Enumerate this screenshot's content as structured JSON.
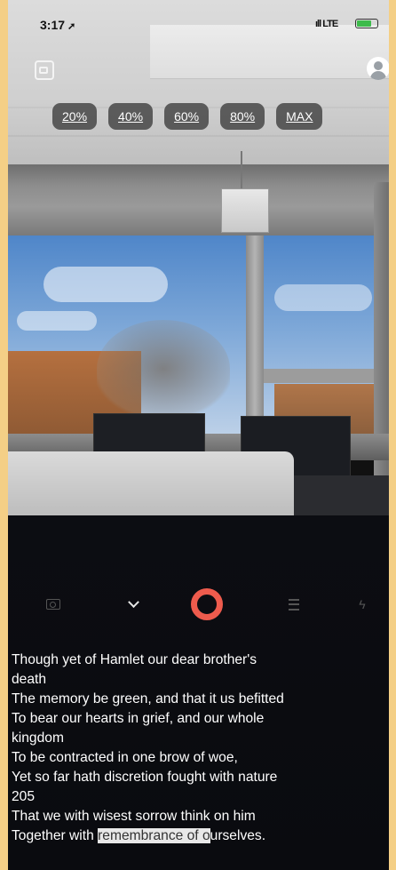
{
  "status_bar": {
    "time": "3:17",
    "location_glyph": "➚",
    "signal": "ıll LTE"
  },
  "zoom_options": [
    "20%",
    "40%",
    "60%",
    "80%",
    "MAX"
  ],
  "icons": {
    "gallery": "gallery-icon",
    "profile": "profile-icon",
    "camera": "camera-icon",
    "collapse": "chevron-down-icon",
    "record": "record-icon",
    "menu": "menu-icon",
    "flash": "flash-icon",
    "flash_glyph": "ϟ"
  },
  "colors": {
    "record": "#ee5b4d",
    "battery": "#3dbb4b",
    "background_frame": "#f4cf86"
  },
  "transcript": {
    "lines": [
      " Though yet of Hamlet our dear brother's",
      "death",
      "The memory be green, and that it us befitted",
      "To bear our hearts in grief, and our whole",
      "kingdom",
      "To be contracted in one brow of woe,",
      "Yet so far hath discretion fought with nature",
      "205",
      "That we with wisest sorrow think on him"
    ],
    "last_line_start": "Together with ",
    "last_line_highlight": "remembrance of o",
    "last_line_end": "urselves."
  }
}
